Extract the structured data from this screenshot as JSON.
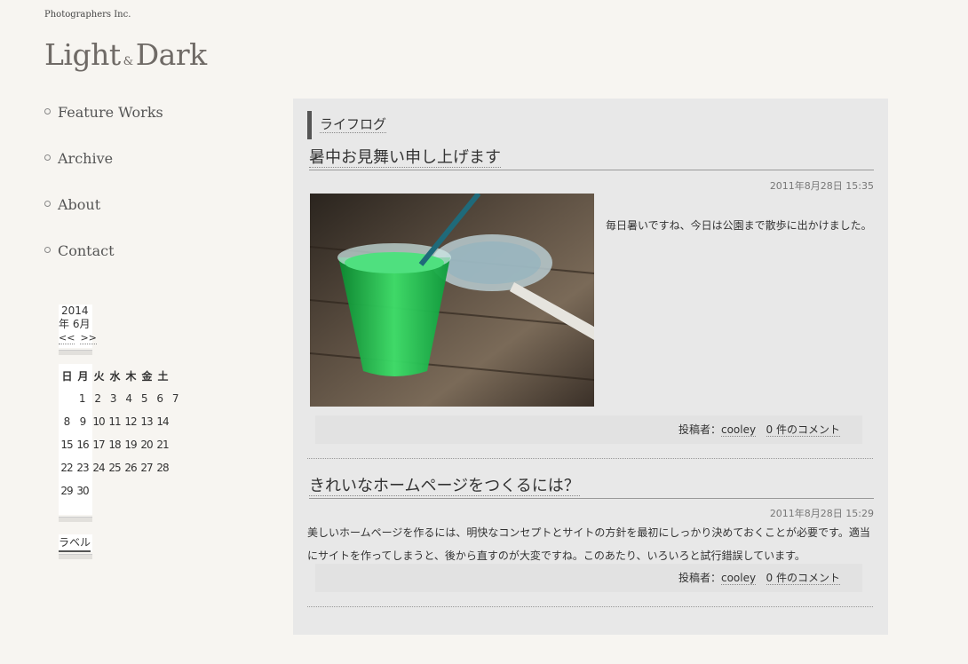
{
  "header": {
    "company": "Photographers Inc.",
    "logo_left": "Light",
    "logo_amp": "&",
    "logo_right": "Dark"
  },
  "nav": [
    "Feature Works",
    "Archive",
    "About",
    "Contact"
  ],
  "calendar": {
    "year": "2014",
    "month": "年 6月",
    "prev": "<<",
    "next": ">>",
    "weekdays": [
      "日",
      "月",
      "火",
      "水",
      "木",
      "金",
      "土"
    ],
    "weeks": [
      [
        "",
        "1",
        "2",
        "3",
        "4",
        "5",
        "6",
        "7"
      ],
      [
        "8",
        "9",
        "10",
        "11",
        "12",
        "13",
        "14"
      ],
      [
        "15",
        "16",
        "17",
        "18",
        "19",
        "20",
        "21"
      ],
      [
        "22",
        "23",
        "24",
        "25",
        "26",
        "27",
        "28"
      ],
      [
        "29",
        "30"
      ]
    ],
    "label": "ラベル"
  },
  "main": {
    "section_title": "ライフログ",
    "posts": [
      {
        "title": "暑中お見舞い申し上げます",
        "date": "2011年8月28日  15:35",
        "body": "毎日暑いですね、今日は公園まで散歩に出かけました。",
        "author_label": "投稿者：",
        "author": "cooley",
        "comments": "0 件のコメント"
      },
      {
        "title": "きれいなホームページをつくるには？",
        "date": "2011年8月28日  15:29",
        "body": "美しいホームページを作るには、明快なコンセプトとサイトの方針を最初にしっかり決めておくことが必要です。適当にサイトを作ってしまうと、後から直すのが大変ですね。このあたり、いろいろと試行錯誤しています。",
        "author_label": "投稿者：",
        "author": "cooley",
        "comments": "0 件のコメント"
      }
    ]
  }
}
